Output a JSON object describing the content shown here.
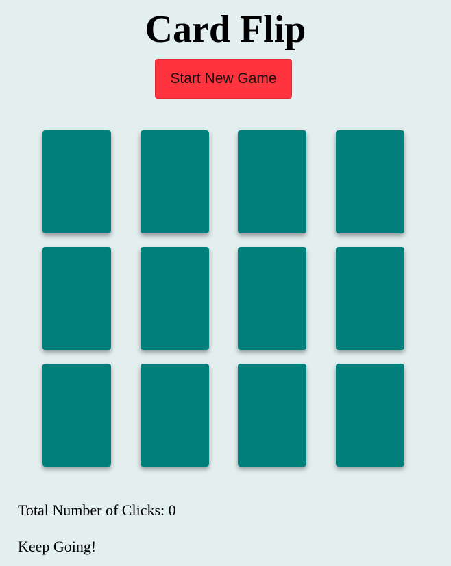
{
  "header": {
    "title": "Card Flip",
    "start_button_label": "Start New Game"
  },
  "board": {
    "rows": 3,
    "columns": 4,
    "cards": [
      {
        "state": "face-down"
      },
      {
        "state": "face-down"
      },
      {
        "state": "face-down"
      },
      {
        "state": "face-down"
      },
      {
        "state": "face-down"
      },
      {
        "state": "face-down"
      },
      {
        "state": "face-down"
      },
      {
        "state": "face-down"
      },
      {
        "state": "face-down"
      },
      {
        "state": "face-down"
      },
      {
        "state": "face-down"
      },
      {
        "state": "face-down"
      }
    ],
    "card_back_color": "#007f7b"
  },
  "footer": {
    "clicks_label": "Total Number of Clicks: 0",
    "status_text": "Keep Going!"
  },
  "colors": {
    "background": "#e3eeee",
    "button": "#ff343f"
  }
}
